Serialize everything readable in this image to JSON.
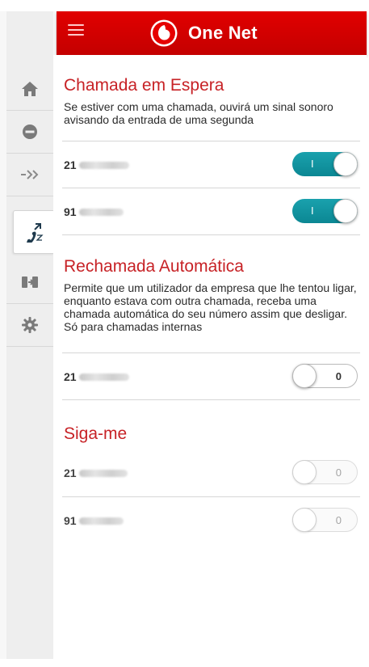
{
  "header": {
    "title": "One Net",
    "brand_color": "#e60000"
  },
  "sidebar": {
    "items": [
      {
        "icon": "home-icon",
        "active": false
      },
      {
        "icon": "do-not-disturb-icon",
        "active": false
      },
      {
        "icon": "forward-arrows-icon",
        "active": false
      },
      {
        "icon": "call-waiting-icon",
        "active": true
      },
      {
        "icon": "transfer-icon",
        "active": false
      },
      {
        "icon": "gear-icon",
        "active": false
      }
    ]
  },
  "sections": {
    "call_waiting": {
      "title": "Chamada em Espera",
      "description": "Se estiver com uma chamada, ouvirá um sinal sonoro avisando da entrada de uma segunda",
      "rows": [
        {
          "prefix": "21",
          "toggle_label": "I",
          "state": "on"
        },
        {
          "prefix": "91",
          "toggle_label": "I",
          "state": "on"
        }
      ]
    },
    "auto_recall": {
      "title": "Rechamada Automática",
      "description": "Permite que um utilizador da empresa que lhe tentou ligar, enquanto estava com outra chamada, receba uma chamada automática do seu número assim que desligar. Só para chamadas internas",
      "rows": [
        {
          "prefix": "21",
          "toggle_label": "0",
          "state": "off"
        }
      ]
    },
    "follow_me": {
      "title": "Siga-me",
      "rows": [
        {
          "prefix": "21",
          "toggle_label": "0",
          "state": "disabled"
        },
        {
          "prefix": "91",
          "toggle_label": "0",
          "state": "disabled"
        }
      ]
    }
  },
  "colors": {
    "toggle_on": "#0f8f9b",
    "section_title": "#c72226"
  }
}
